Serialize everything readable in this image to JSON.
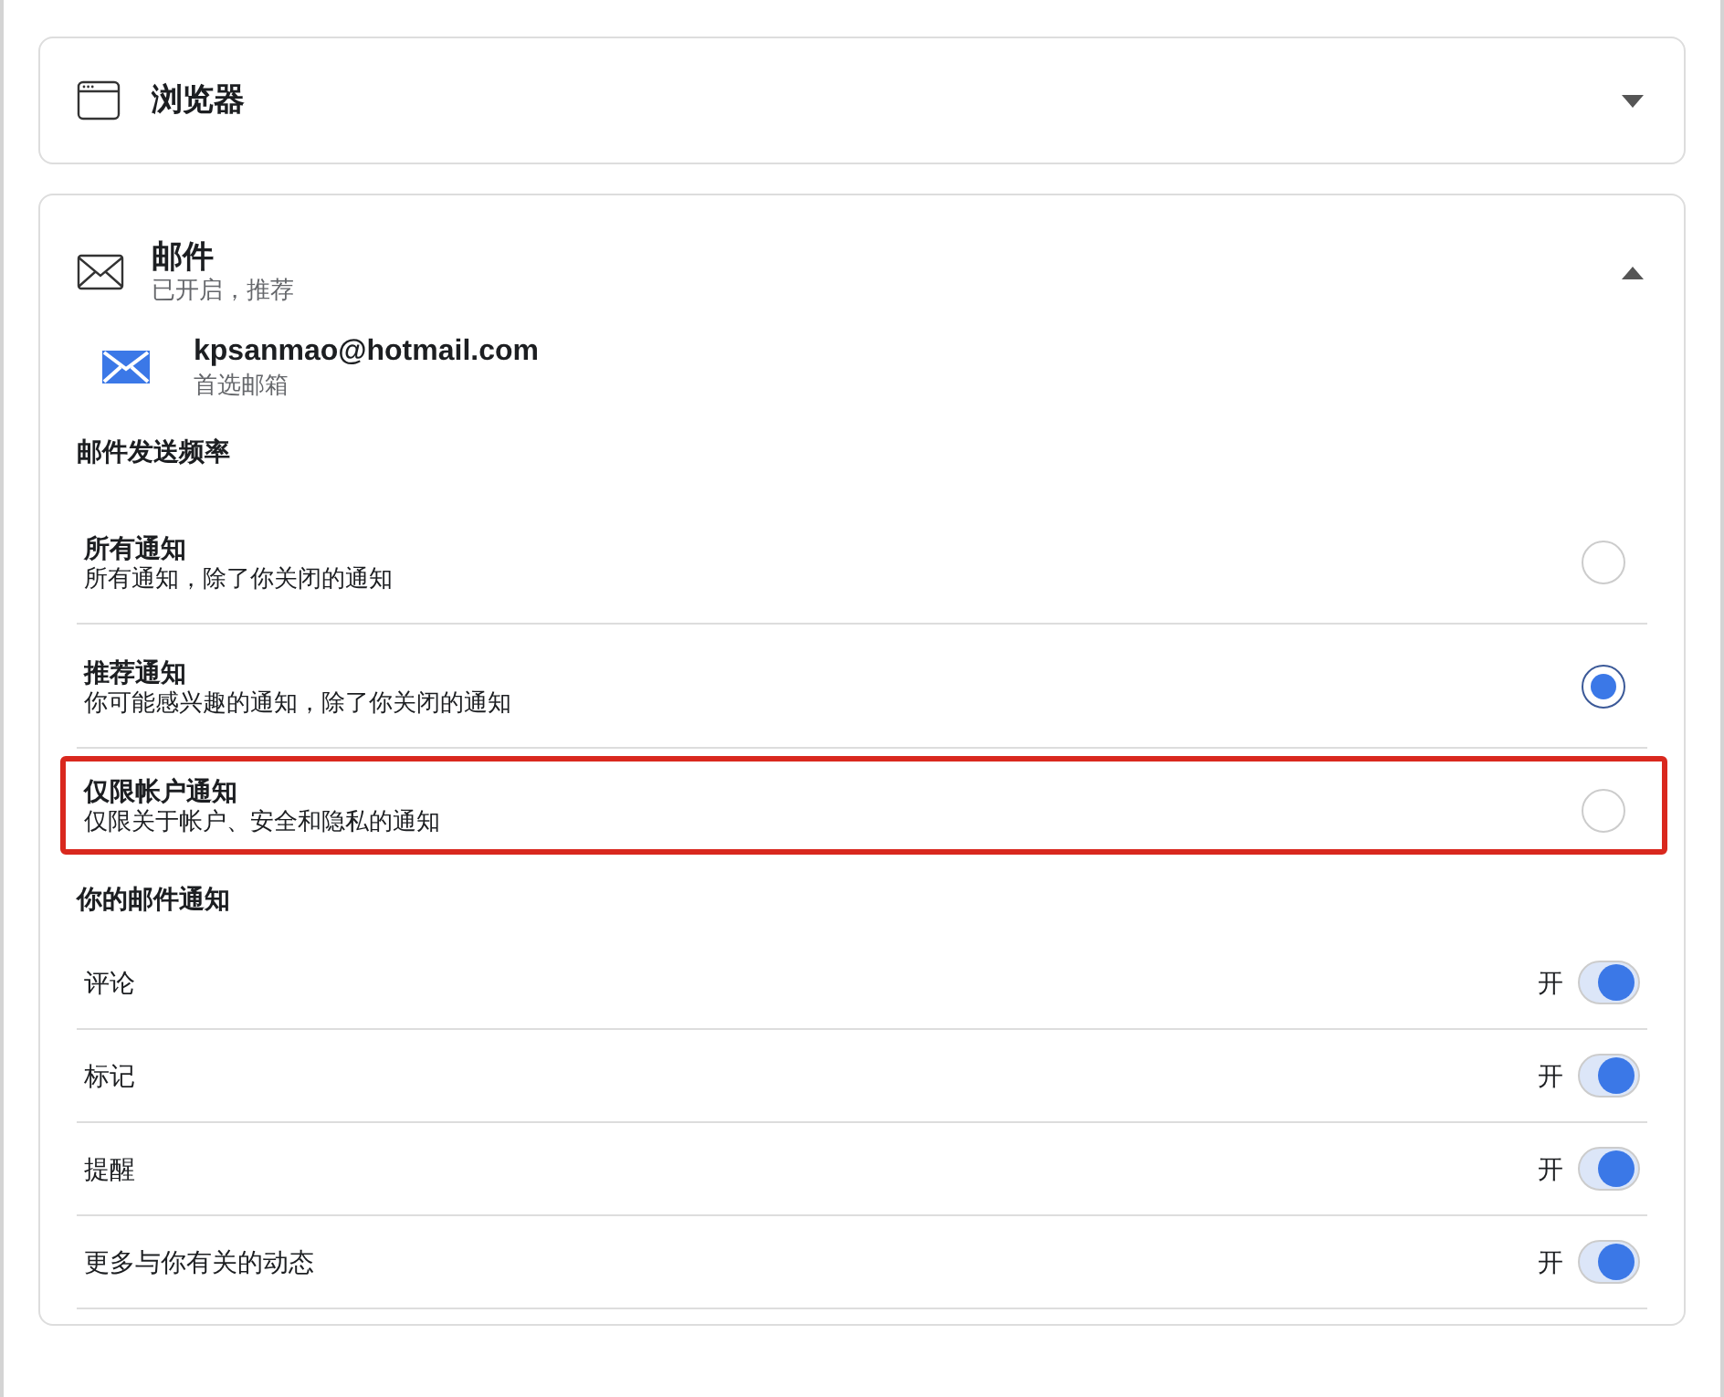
{
  "sections": [
    {
      "title": "浏览器",
      "kind": "browser",
      "expanded": false
    },
    {
      "title": "邮件",
      "subtitle": "已开启，推荐",
      "kind": "mail",
      "expanded": true,
      "account": {
        "email": "kpsanmao@hotmail.com",
        "note": "首选邮箱"
      },
      "frequency": {
        "heading": "邮件发送频率",
        "options": [
          {
            "title": "所有通知",
            "description": "所有通知，除了你关闭的通知",
            "selected": false,
            "highlighted": false
          },
          {
            "title": "推荐通知",
            "description": "你可能感兴趣的通知，除了你关闭的通知",
            "selected": true,
            "highlighted": false
          },
          {
            "title": "仅限帐户通知",
            "description": "仅限关于帐户、安全和隐私的通知",
            "selected": false,
            "highlighted": true
          }
        ]
      },
      "notifications": {
        "heading": "你的邮件通知",
        "items": [
          {
            "label": "评论",
            "state_text": "开",
            "on": true
          },
          {
            "label": "标记",
            "state_text": "开",
            "on": true
          },
          {
            "label": "提醒",
            "state_text": "开",
            "on": true
          },
          {
            "label": "更多与你有关的动态",
            "state_text": "开",
            "on": true
          }
        ]
      }
    }
  ]
}
